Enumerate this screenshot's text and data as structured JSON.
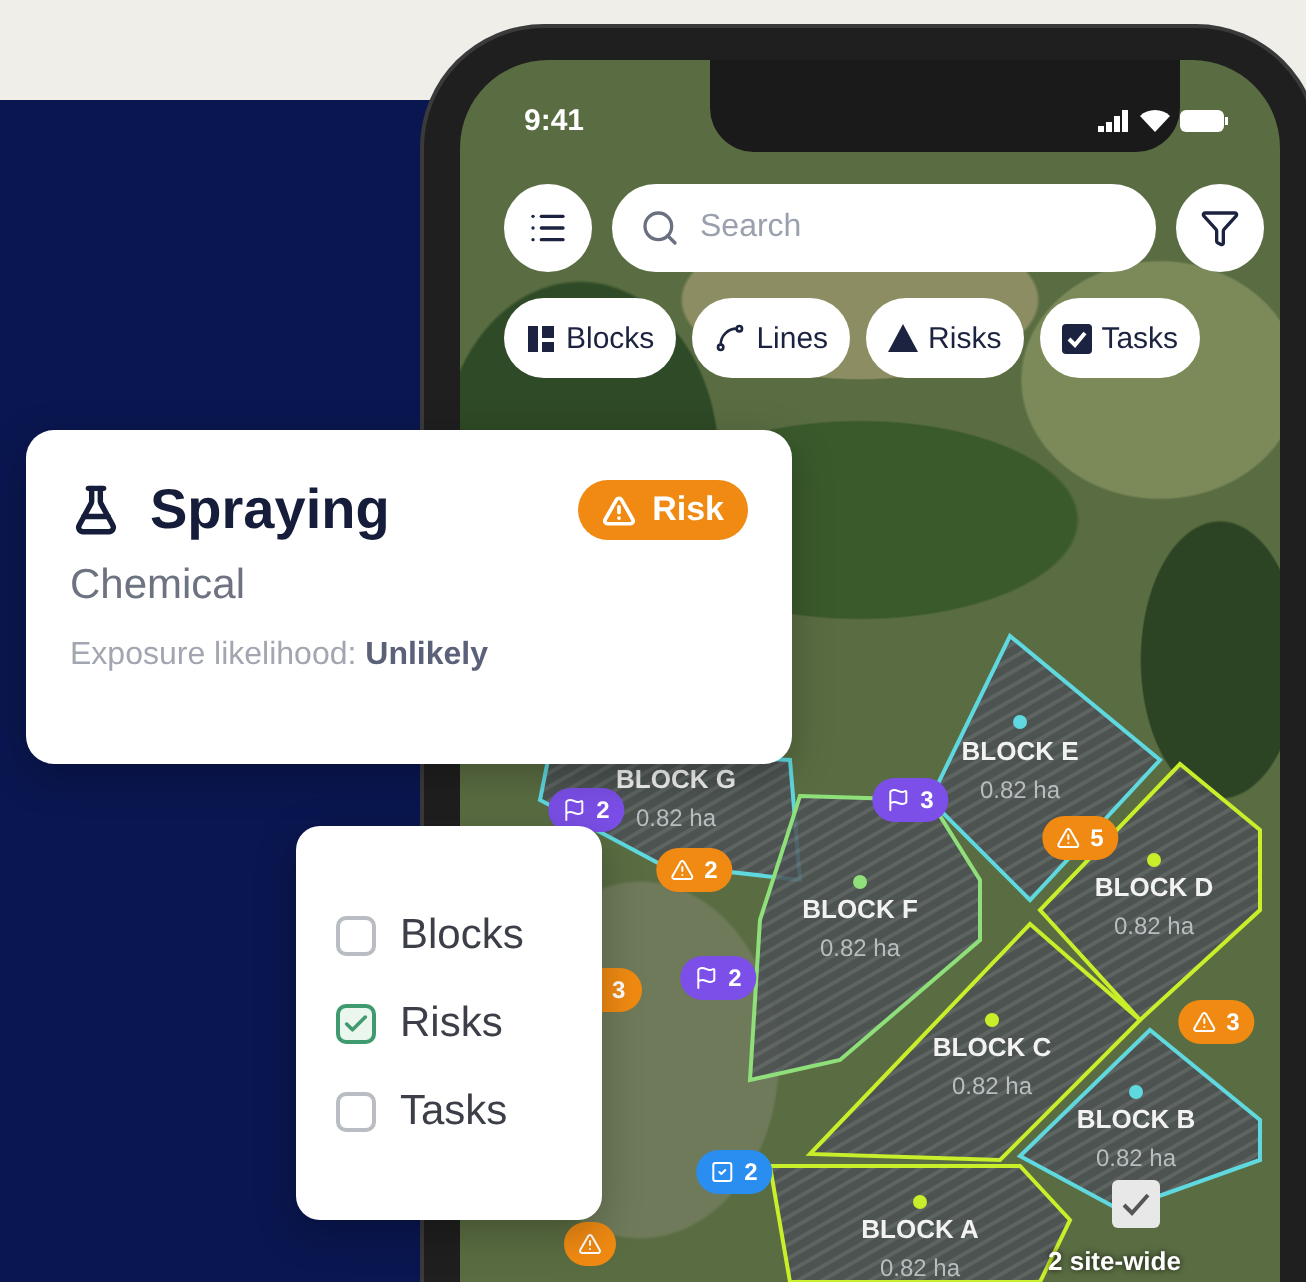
{
  "status_bar": {
    "time": "9:41"
  },
  "toolbar": {
    "search": {
      "placeholder": "Search"
    }
  },
  "layer_chips": [
    {
      "label": "Blocks",
      "kind": "blocks"
    },
    {
      "label": "Lines",
      "kind": "lines"
    },
    {
      "label": "Risks",
      "kind": "risks"
    },
    {
      "label": "Tasks",
      "kind": "tasks"
    }
  ],
  "map": {
    "blocks": [
      {
        "name": "BLOCK G",
        "area": "0.82 ha",
        "color": "#5fd8e0"
      },
      {
        "name": "BLOCK E",
        "area": "0.82 ha",
        "color": "#5fd8e0"
      },
      {
        "name": "BLOCK F",
        "area": "0.82 ha",
        "color": "#8fe07a"
      },
      {
        "name": "BLOCK D",
        "area": "0.82 ha",
        "color": "#c8ef2a"
      },
      {
        "name": "BLOCK C",
        "area": "0.82 ha",
        "color": "#c8ef2a"
      },
      {
        "name": "BLOCK B",
        "area": "0.82 ha",
        "color": "#5fd8e0"
      },
      {
        "name": "BLOCK A",
        "area": "0.82 ha",
        "color": "#c8ef2a"
      }
    ],
    "markers": [
      {
        "kind": "flag",
        "count": "2"
      },
      {
        "kind": "flag",
        "count": "3"
      },
      {
        "kind": "risk",
        "count": "2"
      },
      {
        "kind": "risk",
        "count": "5"
      },
      {
        "kind": "risk",
        "count": "3"
      },
      {
        "kind": "risk",
        "count": "3",
        "partial": true
      },
      {
        "kind": "flag",
        "count": "2"
      },
      {
        "kind": "task",
        "count": "2"
      },
      {
        "kind": "risk"
      }
    ],
    "site_wide": {
      "label": "2 site-wide"
    }
  },
  "risk_card": {
    "title": "Spraying",
    "badge": "Risk",
    "category": "Chemical",
    "detail": "Exposure likelihood: **Unlikely**"
  },
  "layer_filter": [
    {
      "label": "Blocks",
      "checked": false
    },
    {
      "label": "Risks",
      "checked": true
    },
    {
      "label": "Tasks",
      "checked": false
    }
  ]
}
